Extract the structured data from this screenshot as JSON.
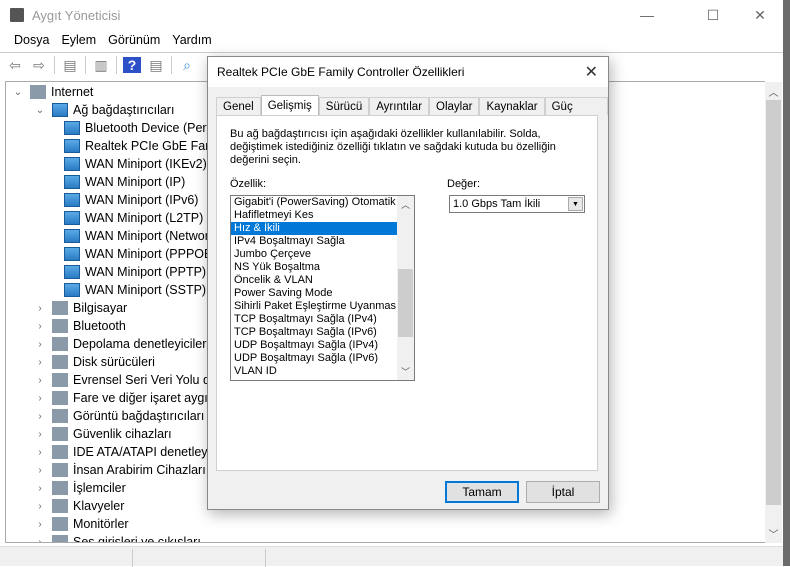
{
  "window": {
    "title": "Aygıt Yöneticisi",
    "minimize": "—",
    "maximize": "☐",
    "close": "✕"
  },
  "menu": [
    "Dosya",
    "Eylem",
    "Görünüm",
    "Yardım"
  ],
  "tree": [
    {
      "label": "Internet",
      "level": 0,
      "expanded": true
    },
    {
      "label": "Ağ bağdaştırıcıları",
      "level": 1,
      "expanded": true
    },
    {
      "label": "Bluetooth Device (Personal Area Network)",
      "level": 2
    },
    {
      "label": "Realtek PCIe GbE Family Controller",
      "level": 2
    },
    {
      "label": "WAN Miniport (IKEv2)",
      "level": 2
    },
    {
      "label": "WAN Miniport (IP)",
      "level": 2
    },
    {
      "label": "WAN Miniport (IPv6)",
      "level": 2
    },
    {
      "label": "WAN Miniport (L2TP)",
      "level": 2
    },
    {
      "label": "WAN Miniport (Network Monitor)",
      "level": 2
    },
    {
      "label": "WAN Miniport (PPPOE)",
      "level": 2
    },
    {
      "label": "WAN Miniport (PPTP)",
      "level": 2
    },
    {
      "label": "WAN Miniport (SSTP)",
      "level": 2
    },
    {
      "label": "Bilgisayar",
      "level": 1
    },
    {
      "label": "Bluetooth",
      "level": 1
    },
    {
      "label": "Depolama denetleyicileri",
      "level": 1
    },
    {
      "label": "Disk sürücüleri",
      "level": 1
    },
    {
      "label": "Evrensel Seri Veri Yolu denetleyicileri",
      "level": 1
    },
    {
      "label": "Fare ve diğer işaret aygıtları",
      "level": 1
    },
    {
      "label": "Görüntü bağdaştırıcıları",
      "level": 1
    },
    {
      "label": "Güvenlik cihazları",
      "level": 1
    },
    {
      "label": "IDE ATA/ATAPI denetleyicileri",
      "level": 1
    },
    {
      "label": "İnsan Arabirim Cihazları",
      "level": 1
    },
    {
      "label": "İşlemciler",
      "level": 1
    },
    {
      "label": "Klavyeler",
      "level": 1
    },
    {
      "label": "Monitörler",
      "level": 1
    },
    {
      "label": "Ses girişleri ve çıkışları",
      "level": 1
    }
  ],
  "dialog": {
    "title": "Realtek PCIe GbE Family Controller Özellikleri",
    "tabs": [
      "Genel",
      "Gelişmiş",
      "Sürücü",
      "Ayrıntılar",
      "Olaylar",
      "Kaynaklar",
      "Güç Yönetimi"
    ],
    "active_tab": 1,
    "description": "Bu ağ bağdaştırıcısı için aşağıdaki özellikler kullanılabilir. Solda, değiştimek istediğiniz özelliği tıklatın ve sağdaki kutuda bu özelliğin değerini seçin.",
    "property_label": "Özellik:",
    "value_label": "Değer:",
    "properties": [
      "Gigabit'i (PowerSaving) Otomatik Devre Dışı Bırak",
      "Hafifletmeyi Kes",
      "Hız & İkili",
      "IPv4 Boşaltmayı Sağla",
      "Jumbo Çerçeve",
      "NS Yük Boşaltma",
      "Öncelik & VLAN",
      "Power Saving Mode",
      "Sihirli Paket Eşleştirme Uyanması",
      "TCP Boşaltmayı Sağla (IPv4)",
      "TCP Boşaltmayı Sağla (IPv6)",
      "UDP Boşaltmayı Sağla (IPv4)",
      "UDP Boşaltmayı Sağla (IPv6)",
      "VLAN ID"
    ],
    "selected_property": 2,
    "value": "1.0 Gbps Tam İkili",
    "ok": "Tamam",
    "cancel": "İptal"
  }
}
